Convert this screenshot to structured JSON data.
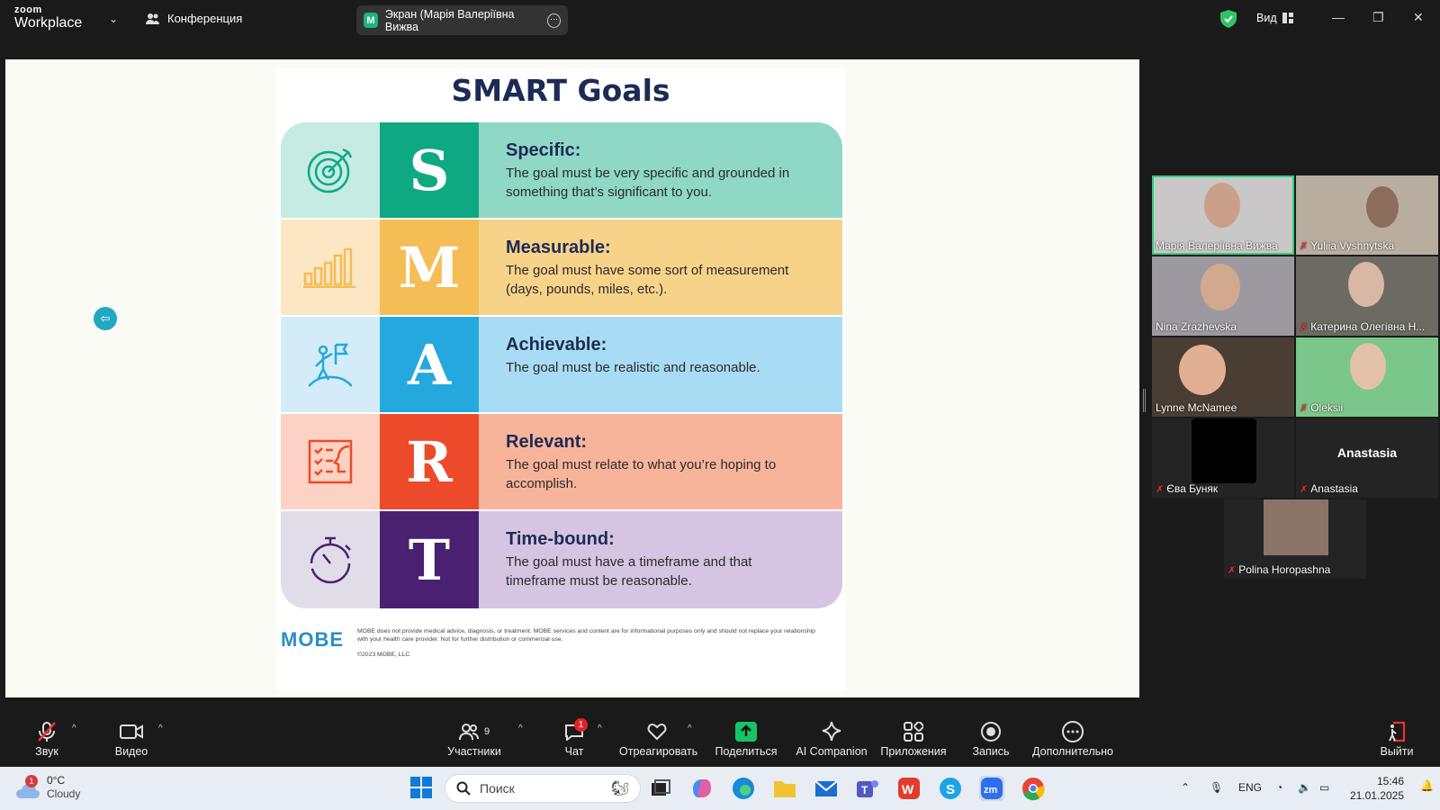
{
  "window": {
    "logo_top": "zoom",
    "logo_bottom": "Workplace",
    "meeting_menu": "Конференция",
    "share_pill_initial": "M",
    "share_pill_label": "Экран (Марія Валеріївна Вижва",
    "view_label": "Вид"
  },
  "slide": {
    "title": "SMART Goals",
    "rows": [
      {
        "letter": "S",
        "heading": "Specific:",
        "text": "The goal must be very specific and grounded in something that’s significant to you.",
        "icon": "target-icon"
      },
      {
        "letter": "M",
        "heading": "Measurable:",
        "text": "The goal must have some sort of measurement (days, pounds, miles, etc.).",
        "icon": "bar-chart-icon"
      },
      {
        "letter": "A",
        "heading": "Achievable:",
        "text": "The goal must be realistic and reasonable.",
        "icon": "summit-flag-icon"
      },
      {
        "letter": "R",
        "heading": "Relevant:",
        "text": "The goal must relate to what you’re hoping to accomplish.",
        "icon": "checklist-icon"
      },
      {
        "letter": "T",
        "heading": "Time-bound:",
        "text": "The goal must have a timeframe and that timeframe must be reasonable.",
        "icon": "stopwatch-icon"
      }
    ],
    "brand": "MOBE",
    "disclaimer": "MOBE does not provide medical advice, diagnosis, or treatment. MOBE services and content are for informational purposes only and should not replace your relationship with your health care provider. Not for further distribution or commercial use.",
    "copyright": "©2023 MOBE, LLC"
  },
  "participants": [
    {
      "name": "Марія Валеріївна Вижва",
      "muted": false
    },
    {
      "name": "Yuliia Vyshnytska",
      "muted": true
    },
    {
      "name": "Nina Zrazhevska",
      "muted": false
    },
    {
      "name": "Катерина Олегівна Н...",
      "muted": true
    },
    {
      "name": "Lynne McNamee",
      "muted": false
    },
    {
      "name": "Oleksii",
      "muted": true
    },
    {
      "name": "Єва Буняк",
      "muted": true
    },
    {
      "name": "Anastasia",
      "muted": true
    },
    {
      "name": "Polina Horopashna",
      "muted": true
    }
  ],
  "placeholder_name": "Anastasia",
  "toolbar": {
    "audio": "Звук",
    "video": "Видео",
    "participants": "Участники",
    "participants_count": "9",
    "chat": "Чат",
    "chat_badge": "1",
    "react": "Отреагировать",
    "share": "Поделиться",
    "ai": "AI Companion",
    "apps": "Приложения",
    "record": "Запись",
    "more": "Дополнительно",
    "leave": "Выйти"
  },
  "taskbar": {
    "weather_badge": "1",
    "temp": "0°C",
    "condition": "Cloudy",
    "search_placeholder": "Поиск",
    "lang": "ENG",
    "time": "15:46",
    "date": "21.01.2025"
  },
  "colors": {
    "S": {
      "icon_bg": "#c6ebe2",
      "letter_bg": "#0ea983",
      "text_bg": "#8fd8c6"
    },
    "M": {
      "icon_bg": "#fbe7c4",
      "letter_bg": "#f4bd55",
      "text_bg": "#f7d38a"
    },
    "A": {
      "icon_bg": "#d4ecf8",
      "letter_bg": "#24a8de",
      "text_bg": "#a8dcf4"
    },
    "R": {
      "icon_bg": "#fbd2c3",
      "letter_bg": "#ec4a2a",
      "text_bg": "#f8b49b"
    },
    "T": {
      "icon_bg": "#e1dde8",
      "letter_bg": "#4a2171",
      "text_bg": "#d5c5e2"
    }
  }
}
